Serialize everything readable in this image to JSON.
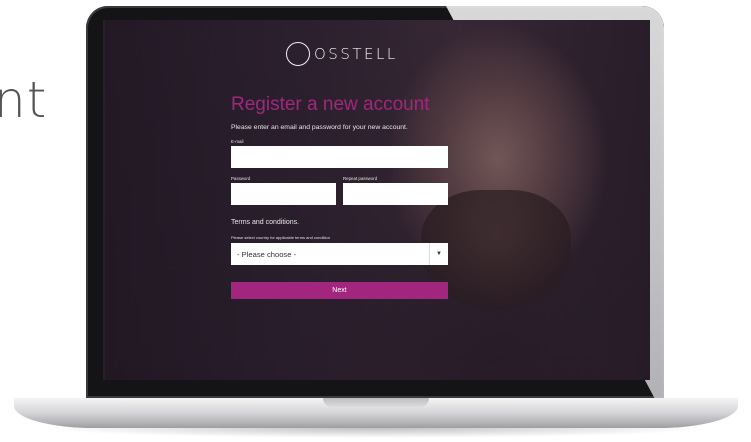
{
  "backdrop_text": "nt",
  "brand": {
    "name": "OSSTELL"
  },
  "form": {
    "title": "Register a new account",
    "intro": "Please enter an email and password for your new account.",
    "email_label": "E-mail",
    "email_value": "",
    "password_label": "Password",
    "password_value": "",
    "repeat_password_label": "Repeat password",
    "repeat_password_value": "",
    "terms_heading": "Terms and conditions.",
    "country_label": "Please select country for applicable terms and condition",
    "country_selected": "- Please choose -",
    "next_label": "Next"
  },
  "colors": {
    "accent": "#a3267e",
    "screen_background": "#2f2331",
    "field_background": "#ffffff"
  },
  "icons": {
    "logo": "ring-logo-icon",
    "caret": "caret-down-icon"
  }
}
